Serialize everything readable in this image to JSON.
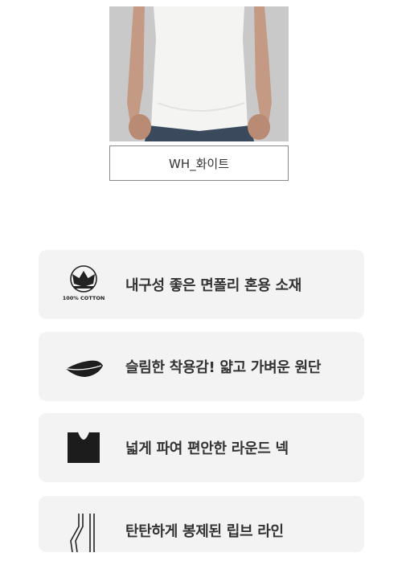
{
  "product": {
    "color_option_label": "WH_화이트"
  },
  "features": [
    {
      "icon": "cotton-icon",
      "icon_text": "100% COTTON",
      "text": "내구성 좋은 면폴리 혼용 소재"
    },
    {
      "icon": "feather-icon",
      "text": "슬림한 착용감! 얇고 가벼운 원단"
    },
    {
      "icon": "round-neck-icon",
      "text": "넓게 파여 편안한 라운드 넥"
    },
    {
      "icon": "rib-line-icon",
      "text": "탄탄하게 봉제된 립브 라인"
    }
  ]
}
